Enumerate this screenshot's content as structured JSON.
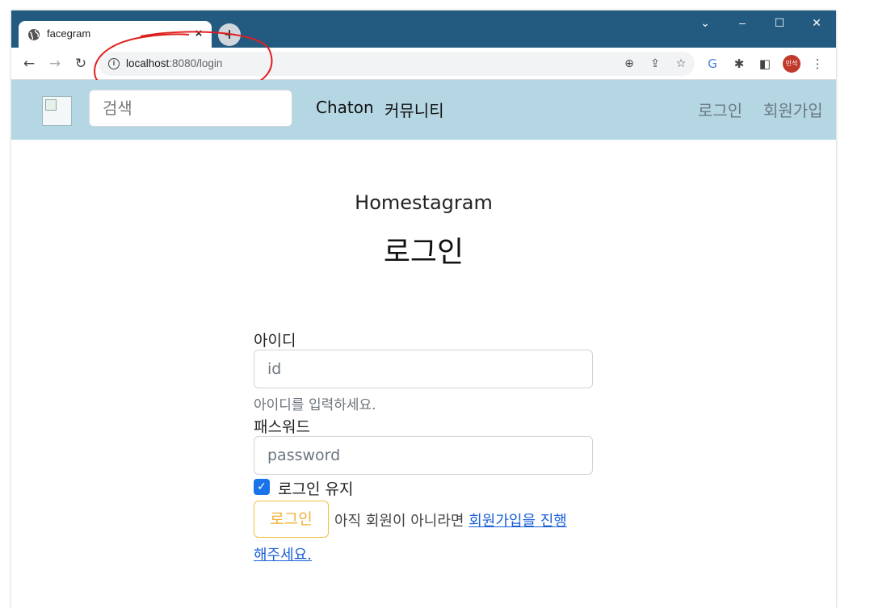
{
  "browser": {
    "tab_title": "facegram",
    "tab_close": "×",
    "new_tab": "+",
    "url_host": "localhost",
    "url_path": ":8080/login",
    "profile_initials": "민석",
    "controls": {
      "dropdown": "⌄",
      "minimize": "–",
      "maximize": "☐",
      "close": "✕"
    }
  },
  "site_nav": {
    "search_placeholder": "검색",
    "links": [
      "Chaton",
      "커뮤니티"
    ],
    "right_links": [
      "로그인",
      "회원가입"
    ]
  },
  "main": {
    "brand": "Homestagram",
    "heading": "로그인"
  },
  "form": {
    "id_label": "아이디",
    "id_placeholder": "id",
    "id_help": "아이디를 입력하세요.",
    "password_label": "패스워드",
    "password_placeholder": "password",
    "remember_label": "로그인 유지",
    "remember_checked": true,
    "submit_label": "로그인",
    "signup_prefix": "아직 회원이 아니라면",
    "signup_link_part1": "회원가입을 진행",
    "signup_link_part2": "해주세요."
  },
  "colors": {
    "titlebar": "#225a80",
    "nav_bg": "#b5d7e3",
    "button_border": "#f0c040",
    "link": "#1a5fd6",
    "annotation": "#e02020"
  }
}
